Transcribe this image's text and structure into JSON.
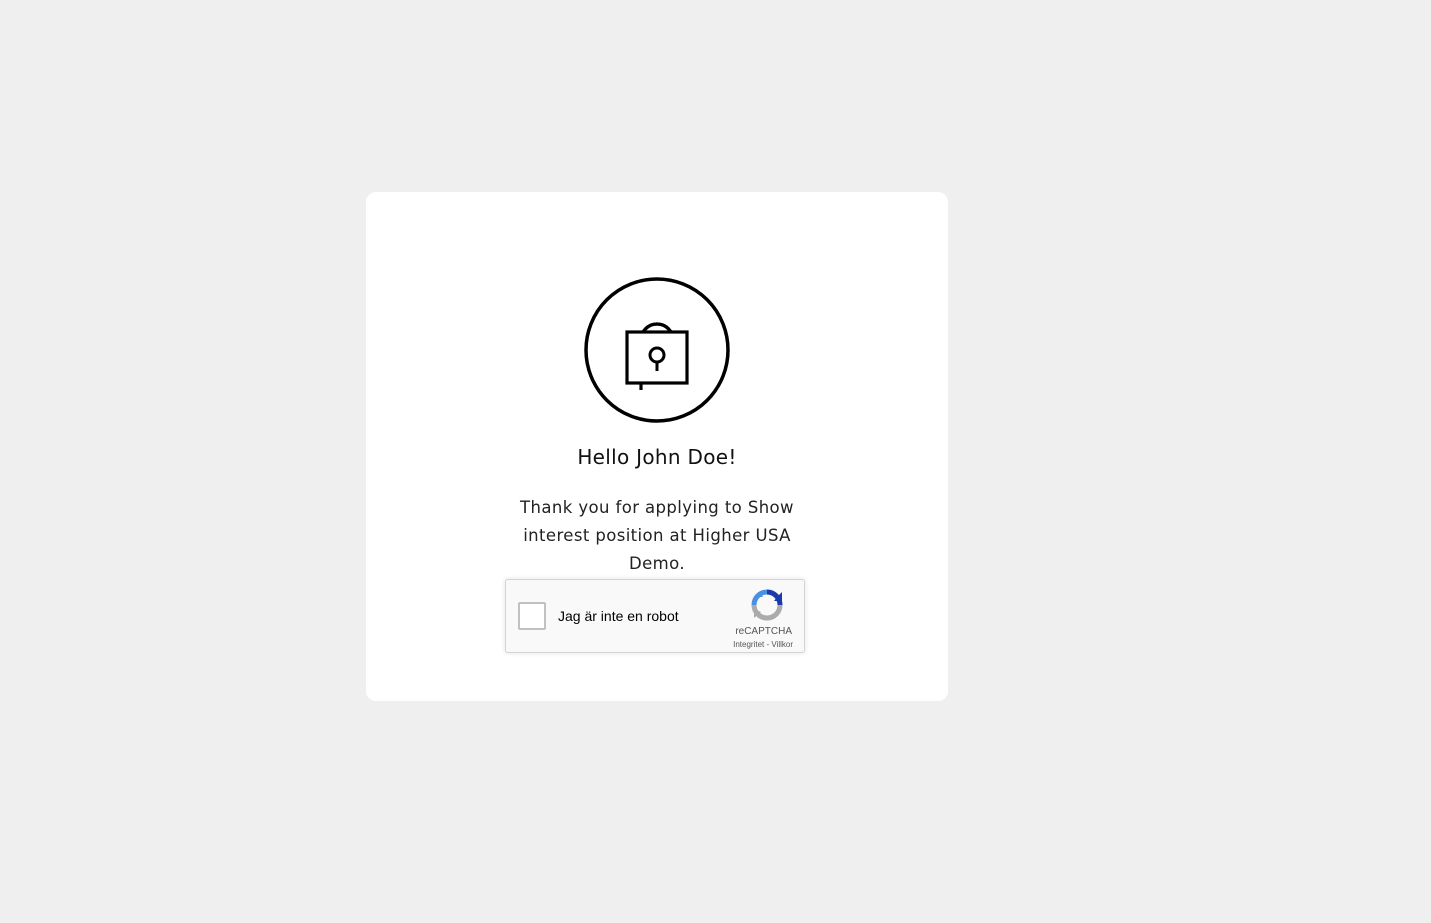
{
  "greeting": "Hello John Doe!",
  "message": "Thank you for applying to Show interest position at Higher USA Demo.",
  "recaptcha": {
    "label": "Jag är inte en robot",
    "brand": "reCAPTCHA",
    "privacy_link": "Integritet",
    "separator": " - ",
    "terms_link": "Villkor"
  },
  "icons": {
    "badge": "lock-icon",
    "captcha": "recaptcha-logo-icon"
  },
  "colors": {
    "page_background": "#efefef",
    "card_background": "#ffffff",
    "icon_stroke": "#000000"
  }
}
